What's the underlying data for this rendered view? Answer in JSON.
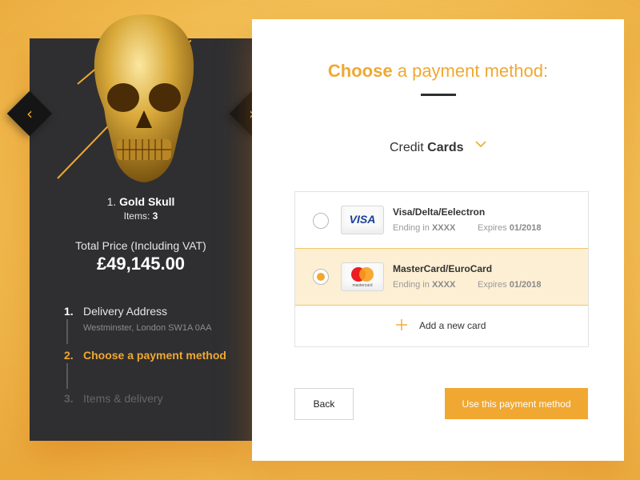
{
  "product": {
    "index": "1.",
    "name": "Gold Skull",
    "items_label": "Items:",
    "items_count": "3",
    "total_label": "Total Price (Including VAT)",
    "total_value": "£49,145.00"
  },
  "steps": [
    {
      "num": "1.",
      "label": "Delivery Address",
      "sub": "Westminster, London SW1A 0AA",
      "state": "done"
    },
    {
      "num": "2.",
      "label": "Choose a payment method",
      "state": "active"
    },
    {
      "num": "3.",
      "label": "Items & delivery",
      "state": "pending"
    }
  ],
  "heading": {
    "bold": "Choose",
    "rest": "a payment method:"
  },
  "card_type": {
    "prefix": "Credit",
    "bold": "Cards"
  },
  "cards": [
    {
      "brand_logo": "VISA",
      "name": "Visa/Delta/Eelectron",
      "ending_label": "Ending in",
      "ending": "XXXX",
      "expires_label": "Expires",
      "expires": "01/2018",
      "selected": false
    },
    {
      "brand_logo": "mastercard",
      "name": "MasterCard/EuroCard",
      "ending_label": "Ending in",
      "ending": "XXXX",
      "expires_label": "Expires",
      "expires": "01/2018",
      "selected": true
    }
  ],
  "add_card_label": "Add a new card",
  "buttons": {
    "back": "Back",
    "use": "Use this payment method"
  },
  "icons": {
    "prev": "chevron-left-icon",
    "next": "chevron-right-icon",
    "dropdown": "chevron-down-icon",
    "add": "plus-icon"
  },
  "colors": {
    "accent": "#f0a832",
    "dark_panel": "#2f2f31",
    "selected_row": "#fdefd3"
  }
}
